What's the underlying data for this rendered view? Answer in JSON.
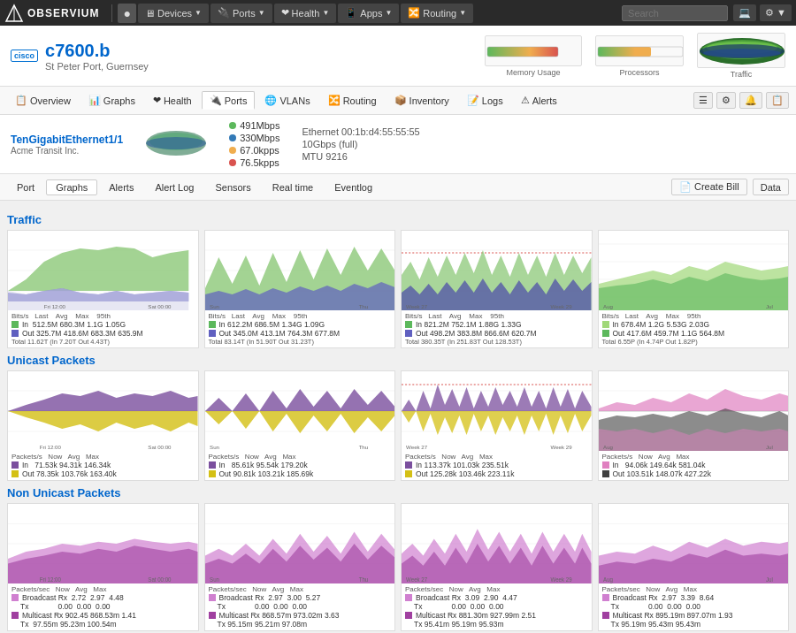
{
  "topnav": {
    "logo": "OBSERVIUM",
    "items": [
      {
        "label": "Devices",
        "icon": "🖥"
      },
      {
        "label": "Ports",
        "icon": "🔌"
      },
      {
        "label": "Health",
        "icon": "❤"
      },
      {
        "label": "Apps",
        "icon": "📱"
      },
      {
        "label": "Routing",
        "icon": "🔀"
      }
    ],
    "search_placeholder": "Search",
    "icons": [
      "💻",
      "⚙"
    ]
  },
  "device": {
    "name": "c7600.b",
    "location": "St Peter Port, Guernsey",
    "cisco_label": "cisco"
  },
  "sec_nav": {
    "items": [
      {
        "label": "Overview",
        "icon": "📋"
      },
      {
        "label": "Graphs",
        "icon": "📊"
      },
      {
        "label": "Health",
        "icon": "❤"
      },
      {
        "label": "Ports",
        "icon": "🔌",
        "active": true
      },
      {
        "label": "VLANs",
        "icon": "🌐"
      },
      {
        "label": "Routing",
        "icon": "🔀"
      },
      {
        "label": "Inventory",
        "icon": "📦"
      },
      {
        "label": "Logs",
        "icon": "📝"
      },
      {
        "label": "Alerts",
        "icon": "⚠"
      }
    ]
  },
  "port": {
    "name": "TenGigabitEthernet1/1",
    "subname": "Acme Transit Inc.",
    "stats": [
      {
        "color": "green",
        "label": "491Mbps"
      },
      {
        "color": "blue",
        "label": "330Mbps"
      },
      {
        "color": "orange",
        "label": "67.0kpps"
      },
      {
        "color": "red",
        "label": "76.5kpps"
      }
    ],
    "details": [
      "Ethernet    00:1b:d4:55:55:55",
      "10Gbps (full)",
      "MTU 9216"
    ]
  },
  "port_subnav": {
    "items": [
      "Port",
      "Graphs",
      "Alerts",
      "Alert Log",
      "Sensors",
      "Real time",
      "Eventlog"
    ],
    "active": "Graphs",
    "right_buttons": [
      "Create Bill",
      "Data"
    ]
  },
  "sections": [
    {
      "title": "Traffic",
      "charts": [
        {
          "time_range": "Fri 12:00 → Sat 00:00",
          "stats": "Bits/s  Last  Avg  Max  95th\nIn  512.5M  680.3M  1.1G  1.05G\nOut  325.7M  418.6M  683.3M  635.9M\nTotal  11.62T (In  7.20T  Out  4.43T)"
        },
        {
          "time_range": "Sun → Thu",
          "stats": "Bits/s  Last  Avg  Max  95th\nIn  612.2M  686.5M  1.34G  1.09G\nOut  345.0M  413.1M  764.3M  677.8M\nTotal  83.14T (In  51.90T  Out  31.23T)"
        },
        {
          "time_range": "Week 27 → Week 29",
          "stats": "Bits/s  Last  Avg  Max  95th\nIn  821.2M  752.1M  1.88G  1.33G\nOut  498.2M  383.8M  866.6M  620.7M\nTotal  380.35T (In  251.83T  Out  128.53T)"
        },
        {
          "time_range": "Aug → Jul",
          "stats": "Bits/s  Last  Avg  Max  95th\nIn  678.4M  1.2G  5.53G  2.03G\nOut  417.6M  459.7M  1.1G  564.8M\nTotal  6.55P (In  4.74P  Out  1.82P)"
        }
      ]
    },
    {
      "title": "Unicast Packets",
      "charts": [
        {
          "time_range": "Fri 12:00 → Sat 00:00",
          "stats": "Packets/s  Now  Avg  Max\nIn  71.53k  94.31k  146.34k\nOut  78.35k  103.76k  163.40k"
        },
        {
          "time_range": "Sun → Thu",
          "stats": "Packets/s  Now  Avg  Max\nIn  85.61k  95.54k  179.20k\nOut  90.81k  103.21k  185.69k"
        },
        {
          "time_range": "Week 27 → Week 29",
          "stats": "Packets/s  Now  Avg  Max\nIn  113.37k  101.03k  235.51k\nOut  125.28k  103.46k  223.11k"
        },
        {
          "time_range": "Aug → Jul",
          "stats": "Packets/s  Now  Avg  Max\nIn  94.06k  149.64k  581.04k\nOut  103.51k  148.07k  427.22k"
        }
      ]
    },
    {
      "title": "Non Unicast Packets",
      "charts": [
        {
          "time_range": "Fri 12:00 → Sat 00:00",
          "stats": "Packets/sec  Now  Avg  Max\nBroadcast Rx  2.72  2.97  4.48\nTx  0.00  0.00  0.00\nMulticast Rx  902.45  868.53M  1.41\nTx  97.55m  95.23m  100.54m"
        },
        {
          "time_range": "Sun → Thu",
          "stats": "Packets/sec  Now  Avg  Max\nBroadcast Rx  2.97  3.00  5.27\nTx  0.00  0.00  0.00\nMulticast Rx  868.57m  973.02m  3.63\nTx  95.15m  95.21m  97.08m"
        },
        {
          "time_range": "Week 27 → Week 29",
          "stats": "Packets/sec  Now  Avg  Max\nBroadcast Rx  3.09  2.90  4.47\nTx  0.00  0.00  0.00\nMulticast Rx  881.30m  927.99m  2.51\nTx  95.41m  95.19m  95.93m"
        },
        {
          "time_range": "Aug → Jul",
          "stats": "Packets/sec  Now  Avg  Max\nBroadcast Rx  2.97  3.39  8.64\nTx  0.00  0.00  0.00\nMulticast Rx  895.19m  897.07m  1.93\nTx  95.19m  95.43m  95.43m"
        }
      ]
    }
  ],
  "colors": {
    "accent": "#0066cc",
    "green": "#5cb85c",
    "blue": "#337ab7",
    "orange": "#f0ad4e",
    "red": "#d9534f",
    "purple": "#7b4f9e",
    "yellow": "#d4c015",
    "pink": "#e080c0"
  }
}
